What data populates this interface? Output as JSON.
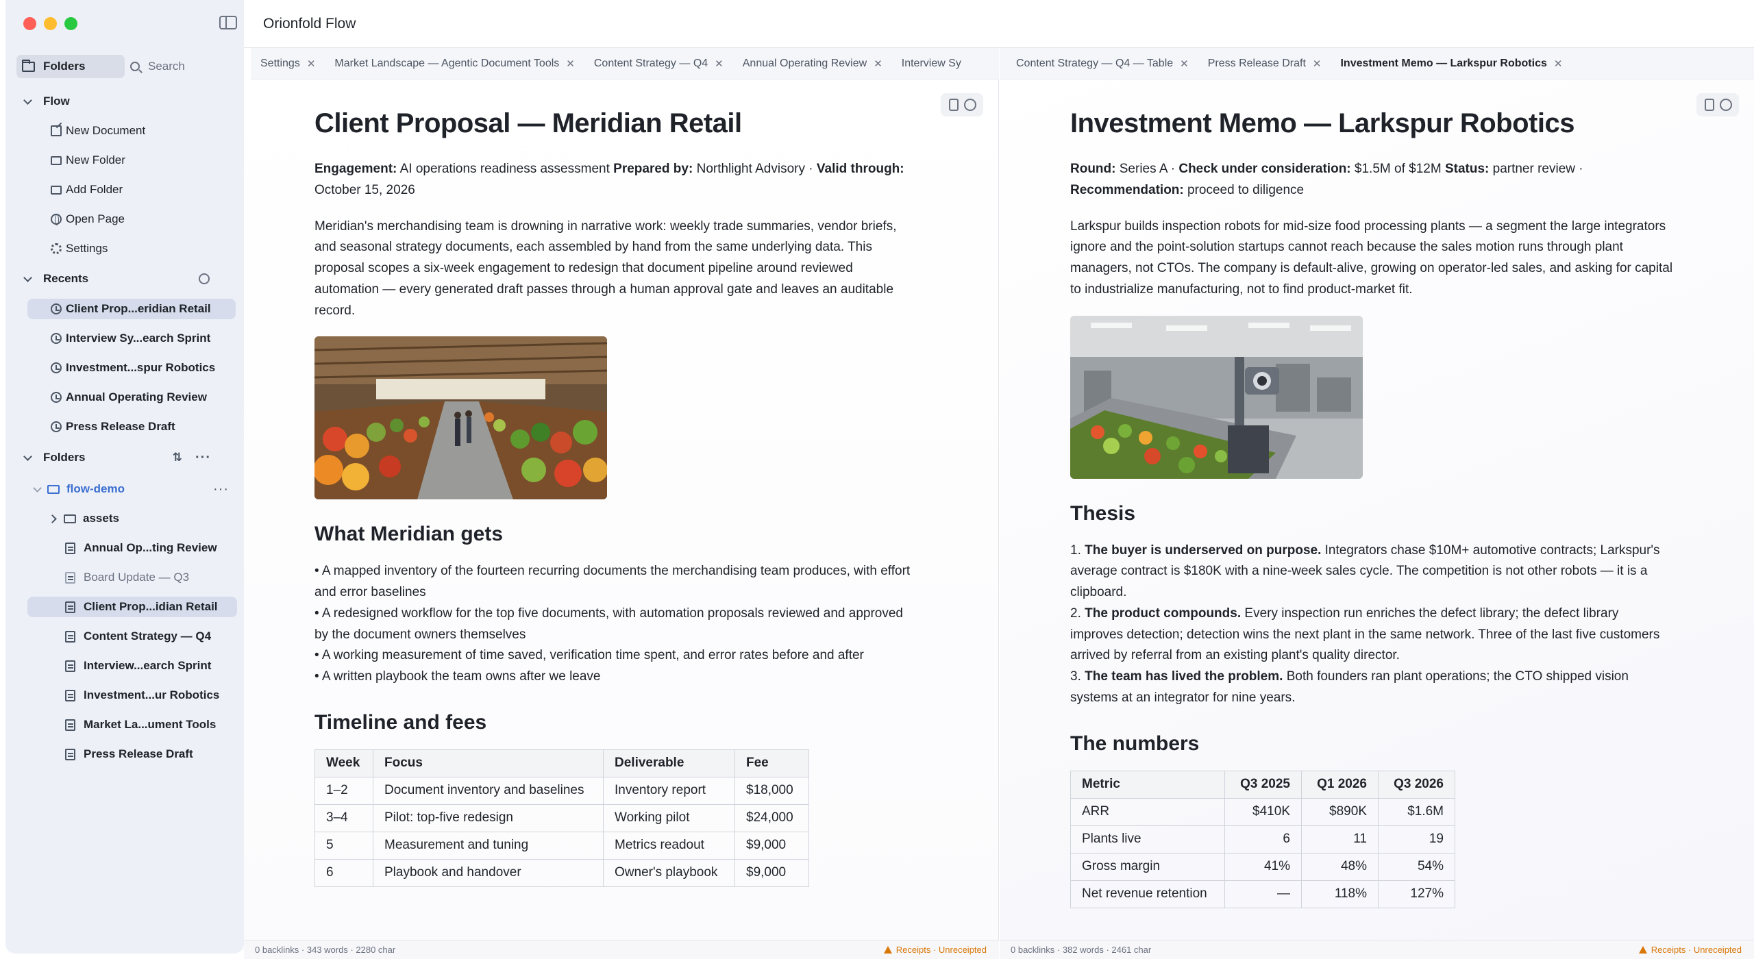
{
  "app": {
    "title": "Orionfold Flow"
  },
  "sidebar": {
    "tab_folders": "Folders",
    "search_placeholder": "Search",
    "flow_section": "Flow",
    "flow_items": [
      {
        "label": "New Document",
        "icon": "edit-icon"
      },
      {
        "label": "New Folder",
        "icon": "folder-plus-icon"
      },
      {
        "label": "Add Folder",
        "icon": "folder-icon"
      },
      {
        "label": "Open Page",
        "icon": "globe-icon"
      },
      {
        "label": "Settings",
        "icon": "gear-icon"
      }
    ],
    "recents_section": "Recents",
    "recents": [
      "Client Prop...eridian Retail",
      "Interview Sy...earch Sprint",
      "Investment...spur Robotics",
      "Annual Operating Review",
      "Press Release Draft"
    ],
    "folders_section": "Folders",
    "root_folder": "flow-demo",
    "subfolder": "assets",
    "files": [
      "Annual Op...ting Review",
      "Board Update — Q3",
      "Client Prop...idian Retail",
      "Content Strategy — Q4",
      "Interview...earch Sprint",
      "Investment...ur Robotics",
      "Market La...ument Tools",
      "Press Release Draft"
    ]
  },
  "tabs_left": [
    "Settings",
    "Market Landscape — Agentic Document Tools",
    "Content Strategy — Q4",
    "Annual Operating Review",
    "Interview Sy"
  ],
  "tabs_right": [
    "Content Strategy — Q4 — Table",
    "Press Release Draft",
    "Investment Memo — Larkspur Robotics"
  ],
  "left_doc": {
    "title": "Client Proposal — Meridian Retail",
    "meta": {
      "engagement_label": "Engagement:",
      "engagement": " AI operations readiness assessment ",
      "prepared_label": "Prepared by:",
      "prepared": " Northlight Advisory · ",
      "valid_label": "Valid through:",
      "valid": " October 15, 2026"
    },
    "intro": "Meridian's merchandising team is drowning in narrative work: weekly trade summaries, vendor briefs, and seasonal strategy documents, each assembled by hand from the same underlying data. This proposal scopes a six-week engagement to redesign that document pipeline around reviewed automation — every generated draft passes through a human approval gate and leaves an auditable record.",
    "h_gets": "What Meridian gets",
    "gets": [
      "A mapped inventory of the fourteen recurring documents the merchandising team produces, with effort and error baselines",
      "A redesigned workflow for the top five documents, with automation proposals reviewed and approved by the document owners themselves",
      "A working measurement of time saved, verification time spent, and error rates before and after",
      "A written playbook the team owns after we leave"
    ],
    "h_timeline": "Timeline and fees",
    "table_headers": [
      "Week",
      "Focus",
      "Deliverable",
      "Fee"
    ],
    "table_rows": [
      [
        "1–2",
        "Document inventory and baselines",
        "Inventory report",
        "$18,000"
      ],
      [
        "3–4",
        "Pilot: top-five redesign",
        "Working pilot",
        "$24,000"
      ],
      [
        "5",
        "Measurement and tuning",
        "Metrics readout",
        "$9,000"
      ],
      [
        "6",
        "Playbook and handover",
        "Owner's playbook",
        "$9,000"
      ]
    ]
  },
  "right_doc": {
    "title": "Investment Memo — Larkspur Robotics",
    "meta": {
      "round_label": "Round:",
      "round": " Series A · ",
      "check_label": "Check under consideration:",
      "check": " $1.5M of $12M ",
      "status_label": "Status:",
      "status": " partner review · ",
      "rec_label": "Recommendation:",
      "rec": " proceed to diligence"
    },
    "intro": "Larkspur builds inspection robots for mid-size food processing plants — a segment the large integrators ignore and the point-solution startups cannot reach because the sales motion runs through plant managers, not CTOs. The company is default-alive, growing on operator-led sales, and asking for capital to industrialize manufacturing, not to find product-market fit.",
    "h_thesis": "Thesis",
    "thesis": [
      {
        "num": "1. ",
        "bold": "The buyer is underserved on purpose.",
        "text": " Integrators chase $10M+ automotive contracts; Larkspur's average contract is $180K with a nine-week sales cycle. The competition is not other robots — it is a clipboard."
      },
      {
        "num": "2. ",
        "bold": "The product compounds.",
        "text": " Every inspection run enriches the defect library; the defect library improves detection; detection wins the next plant in the same network. Three of the last five customers arrived by referral from an existing plant's quality director."
      },
      {
        "num": "3. ",
        "bold": "The team has lived the problem.",
        "text": " Both founders ran plant operations; the CTO shipped vision systems at an integrator for nine years."
      }
    ],
    "h_numbers": "The numbers",
    "table_headers": [
      "Metric",
      "Q3 2025",
      "Q1 2026",
      "Q3 2026"
    ],
    "table_rows": [
      [
        "ARR",
        "$410K",
        "$890K",
        "$1.6M"
      ],
      [
        "Plants live",
        "6",
        "11",
        "19"
      ],
      [
        "Gross margin",
        "41%",
        "48%",
        "54%"
      ],
      [
        "Net revenue retention",
        "—",
        "118%",
        "127%"
      ]
    ]
  },
  "status_left": {
    "info": "0 backlinks · 343 words · 2280 char",
    "warn": "Receipts · Unreceipted"
  },
  "status_right": {
    "info": "0 backlinks · 382 words · 2461 char",
    "warn": "Receipts · Unreceipted"
  }
}
